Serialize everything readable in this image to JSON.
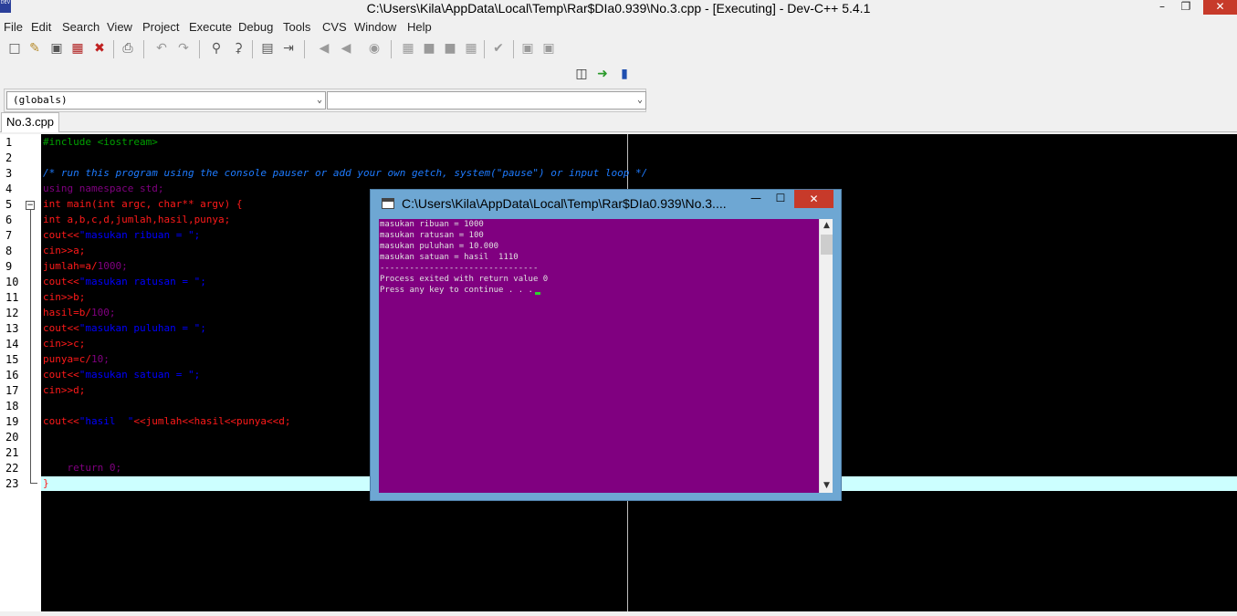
{
  "window": {
    "title": "C:\\Users\\Kila\\AppData\\Local\\Temp\\Rar$DIa0.939\\No.3.cpp - [Executing] - Dev-C++ 5.4.1",
    "app_icon_text": "DEV",
    "minimize_glyph": "–",
    "maximize_glyph": "❐",
    "close_glyph": "✕"
  },
  "menu": {
    "items": [
      "File",
      "Edit",
      "Search",
      "View",
      "Project",
      "Execute",
      "Debug",
      "Tools",
      "CVS",
      "Window",
      "Help"
    ]
  },
  "toolbar": {
    "icons": [
      "new-file-icon",
      "open-file-icon",
      "save-icon",
      "save-all-icon",
      "close-file-icon",
      "print-icon",
      "undo-icon",
      "redo-icon",
      "find-icon",
      "replace-icon",
      "goto-icon",
      "indent-icon",
      "comment-icon",
      "uncomment-icon",
      "stop-icon",
      "compile-icon",
      "run-icon",
      "compile-run-icon",
      "rebuild-icon",
      "check-icon",
      "debug-icon",
      "profile-icon"
    ],
    "secondary_icons": [
      "class-browser-icon",
      "add-project-icon",
      "project-options-icon"
    ]
  },
  "scope": {
    "globals": "(globals)",
    "member": ""
  },
  "tabs": {
    "active": "No.3.cpp"
  },
  "editor": {
    "line_numbers": [
      "1",
      "2",
      "3",
      "4",
      "5",
      "6",
      "7",
      "8",
      "9",
      "10",
      "11",
      "12",
      "13",
      "14",
      "15",
      "16",
      "17",
      "18",
      "19",
      "20",
      "21",
      "22",
      "23"
    ],
    "fold_glyph": "−",
    "lines": {
      "l1": "#include <iostream>",
      "l3": "/* run this program using the console pauser or add your own getch, system(\"pause\") or input loop */",
      "l4": "using namespace std;",
      "l5a": "int main(int argc, char** argv) {",
      "l6": "int a,b,c,d,jumlah,hasil,punya;",
      "l7a": "cout<<",
      "l7b": "\"masukan ribuan = \";",
      "l8": "cin>>a;",
      "l9a": "jumlah=a/",
      "l9b": "1000;",
      "l10a": "cout<<",
      "l10b": "\"masukan ratusan = \";",
      "l11": "cin>>b;",
      "l12a": "hasil=b/",
      "l12b": "100;",
      "l13a": "cout<<",
      "l13b": "\"masukan puluhan = \";",
      "l14": "cin>>c;",
      "l15a": "punya=c/",
      "l15b": "10;",
      "l16a": "cout<<",
      "l16b": "\"masukan satuan = \";",
      "l17": "cin>>d;",
      "l19a": "cout<<",
      "l19b": "\"hasil  \"",
      "l19c": "<<jumlah<<hasil<<punya<<d;",
      "l22": "    return 0;",
      "l23": "}"
    }
  },
  "console": {
    "title": "C:\\Users\\Kila\\AppData\\Local\\Temp\\Rar$DIa0.939\\No.3....",
    "minimize_glyph": "—",
    "maximize_glyph": "☐",
    "close_glyph": "✕",
    "lines": [
      "masukan ribuan = 1000",
      "masukan ratusan = 100",
      "masukan puluhan = 10.000",
      "masukan satuan = hasil  1110",
      "--------------------------------",
      "Process exited with return value 0",
      "Press any key to continue . . ."
    ],
    "scroll_up_glyph": "▲",
    "scroll_down_glyph": "▼"
  }
}
